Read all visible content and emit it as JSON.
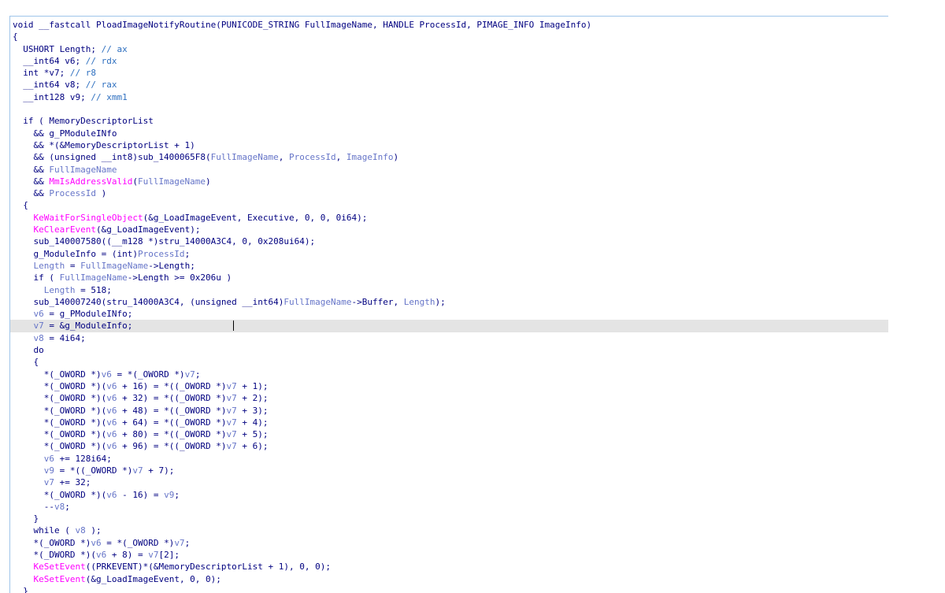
{
  "editor": {
    "lines": [
      [
        [
          "void __fastcall PloadImageNotifyRoutine(PUNICODE_STRING FullImageName, HANDLE ProcessId, PIMAGE_INFO ImageInfo)",
          "normal"
        ]
      ],
      [
        [
          "{",
          "normal"
        ]
      ],
      [
        [
          "  USHORT Length; ",
          "normal"
        ],
        [
          "// ax",
          "comment"
        ]
      ],
      [
        [
          "  __int64 v6; ",
          "normal"
        ],
        [
          "// rdx",
          "comment"
        ]
      ],
      [
        [
          "  int *v7; ",
          "normal"
        ],
        [
          "// r8",
          "comment"
        ]
      ],
      [
        [
          "  __int64 v8; ",
          "normal"
        ],
        [
          "// rax",
          "comment"
        ]
      ],
      [
        [
          "  __int128 v9; ",
          "normal"
        ],
        [
          "// xmm1",
          "comment"
        ]
      ],
      [
        [
          "",
          "normal"
        ]
      ],
      [
        [
          "  if ( ",
          "normal"
        ],
        [
          "MemoryDescriptorList",
          "normal"
        ]
      ],
      [
        [
          "    && ",
          "normal"
        ],
        [
          "g_PModuleINfo",
          "normal"
        ]
      ],
      [
        [
          "    && *(&MemoryDescriptorList + 1)",
          "normal"
        ]
      ],
      [
        [
          "    && (unsigned __int8)sub_1400065F8(",
          "normal"
        ],
        [
          "FullImageName",
          "var"
        ],
        [
          ", ",
          "normal"
        ],
        [
          "ProcessId",
          "var"
        ],
        [
          ", ",
          "normal"
        ],
        [
          "ImageInfo",
          "var"
        ],
        [
          ")",
          "normal"
        ]
      ],
      [
        [
          "    && ",
          "normal"
        ],
        [
          "FullImageName",
          "var"
        ]
      ],
      [
        [
          "    && ",
          "normal"
        ],
        [
          "MmIsAddressValid",
          "func"
        ],
        [
          "(",
          "normal"
        ],
        [
          "FullImageName",
          "var"
        ],
        [
          ")",
          "normal"
        ]
      ],
      [
        [
          "    && ",
          "normal"
        ],
        [
          "ProcessId",
          "var"
        ],
        [
          " )",
          "normal"
        ]
      ],
      [
        [
          "  {",
          "normal"
        ]
      ],
      [
        [
          "    ",
          "normal"
        ],
        [
          "KeWaitForSingleObject",
          "func"
        ],
        [
          "(&g_LoadImageEvent, Executive, 0, 0, 0i64);",
          "normal"
        ]
      ],
      [
        [
          "    ",
          "normal"
        ],
        [
          "KeClearEvent",
          "func"
        ],
        [
          "(&g_LoadImageEvent);",
          "normal"
        ]
      ],
      [
        [
          "    sub_140007580((__m128 *)stru_14000A3C4, 0, 0x208ui64);",
          "normal"
        ]
      ],
      [
        [
          "    g_ModuleInfo = (int)",
          "normal"
        ],
        [
          "ProcessId",
          "var"
        ],
        [
          ";",
          "normal"
        ]
      ],
      [
        [
          "    ",
          "normal"
        ],
        [
          "Length",
          "var"
        ],
        [
          " = ",
          "normal"
        ],
        [
          "FullImageName",
          "var"
        ],
        [
          "->Length;",
          "normal"
        ]
      ],
      [
        [
          "    if ( ",
          "normal"
        ],
        [
          "FullImageName",
          "var"
        ],
        [
          "->Length >= 0x206u )",
          "normal"
        ]
      ],
      [
        [
          "      ",
          "normal"
        ],
        [
          "Length",
          "var"
        ],
        [
          " = 518;",
          "normal"
        ]
      ],
      [
        [
          "    sub_140007240(stru_14000A3C4, (unsigned __int64)",
          "normal"
        ],
        [
          "FullImageName",
          "var"
        ],
        [
          "->Buffer, ",
          "normal"
        ],
        [
          "Length",
          "var"
        ],
        [
          ");",
          "normal"
        ]
      ],
      [
        [
          "    ",
          "normal"
        ],
        [
          "v6",
          "var"
        ],
        [
          " = g_PModuleINfo;",
          "normal"
        ]
      ],
      [
        [
          "    ",
          "normal"
        ],
        [
          "v7",
          "var"
        ],
        [
          " = &g_ModuleInfo;",
          "normal"
        ]
      ],
      [
        [
          "    ",
          "normal"
        ],
        [
          "v8",
          "var"
        ],
        [
          " = 4i64;",
          "normal"
        ]
      ],
      [
        [
          "    do",
          "normal"
        ]
      ],
      [
        [
          "    {",
          "normal"
        ]
      ],
      [
        [
          "      *(_OWORD *)",
          "normal"
        ],
        [
          "v6",
          "var"
        ],
        [
          " = *(_OWORD *)",
          "normal"
        ],
        [
          "v7",
          "var"
        ],
        [
          ";",
          "normal"
        ]
      ],
      [
        [
          "      *(_OWORD *)(",
          "normal"
        ],
        [
          "v6",
          "var"
        ],
        [
          " + 16) = *((_OWORD *)",
          "normal"
        ],
        [
          "v7",
          "var"
        ],
        [
          " + 1);",
          "normal"
        ]
      ],
      [
        [
          "      *(_OWORD *)(",
          "normal"
        ],
        [
          "v6",
          "var"
        ],
        [
          " + 32) = *((_OWORD *)",
          "normal"
        ],
        [
          "v7",
          "var"
        ],
        [
          " + 2);",
          "normal"
        ]
      ],
      [
        [
          "      *(_OWORD *)(",
          "normal"
        ],
        [
          "v6",
          "var"
        ],
        [
          " + 48) = *((_OWORD *)",
          "normal"
        ],
        [
          "v7",
          "var"
        ],
        [
          " + 3);",
          "normal"
        ]
      ],
      [
        [
          "      *(_OWORD *)(",
          "normal"
        ],
        [
          "v6",
          "var"
        ],
        [
          " + 64) = *((_OWORD *)",
          "normal"
        ],
        [
          "v7",
          "var"
        ],
        [
          " + 4);",
          "normal"
        ]
      ],
      [
        [
          "      *(_OWORD *)(",
          "normal"
        ],
        [
          "v6",
          "var"
        ],
        [
          " + 80) = *((_OWORD *)",
          "normal"
        ],
        [
          "v7",
          "var"
        ],
        [
          " + 5);",
          "normal"
        ]
      ],
      [
        [
          "      *(_OWORD *)(",
          "normal"
        ],
        [
          "v6",
          "var"
        ],
        [
          " + 96) = *((_OWORD *)",
          "normal"
        ],
        [
          "v7",
          "var"
        ],
        [
          " + 6);",
          "normal"
        ]
      ],
      [
        [
          "      ",
          "normal"
        ],
        [
          "v6",
          "var"
        ],
        [
          " += 128i64;",
          "normal"
        ]
      ],
      [
        [
          "      ",
          "normal"
        ],
        [
          "v9",
          "var"
        ],
        [
          " = *((_OWORD *)",
          "normal"
        ],
        [
          "v7",
          "var"
        ],
        [
          " + 7);",
          "normal"
        ]
      ],
      [
        [
          "      ",
          "normal"
        ],
        [
          "v7",
          "var"
        ],
        [
          " += 32;",
          "normal"
        ]
      ],
      [
        [
          "      *(_OWORD *)(",
          "normal"
        ],
        [
          "v6",
          "var"
        ],
        [
          " - 16) = ",
          "normal"
        ],
        [
          "v9",
          "var"
        ],
        [
          ";",
          "normal"
        ]
      ],
      [
        [
          "      --",
          "normal"
        ],
        [
          "v8",
          "var"
        ],
        [
          ";",
          "normal"
        ]
      ],
      [
        [
          "    }",
          "normal"
        ]
      ],
      [
        [
          "    while ( ",
          "normal"
        ],
        [
          "v8",
          "var"
        ],
        [
          " );",
          "normal"
        ]
      ],
      [
        [
          "    *(_OWORD *)",
          "normal"
        ],
        [
          "v6",
          "var"
        ],
        [
          " = *(_OWORD *)",
          "normal"
        ],
        [
          "v7",
          "var"
        ],
        [
          ";",
          "normal"
        ]
      ],
      [
        [
          "    *(_DWORD *)(",
          "normal"
        ],
        [
          "v6",
          "var"
        ],
        [
          " + 8) = ",
          "normal"
        ],
        [
          "v7",
          "var"
        ],
        [
          "[2];",
          "normal"
        ]
      ],
      [
        [
          "    ",
          "normal"
        ],
        [
          "KeSetEvent",
          "func"
        ],
        [
          "((PRKEVENT)*(&MemoryDescriptorList + 1), 0, 0);",
          "normal"
        ]
      ],
      [
        [
          "    ",
          "normal"
        ],
        [
          "KeSetEvent",
          "func"
        ],
        [
          "(&g_LoadImageEvent, 0, 0);",
          "normal"
        ]
      ],
      [
        [
          "  }",
          "normal"
        ]
      ]
    ],
    "highlighted_line": 25,
    "colors": {
      "normal": "#000080",
      "comment": "#2f70c0",
      "var": "#6675c8",
      "func": "#ff00ff",
      "highlight_bg": "#e4e4e4",
      "border": "#9ec5ea"
    }
  }
}
